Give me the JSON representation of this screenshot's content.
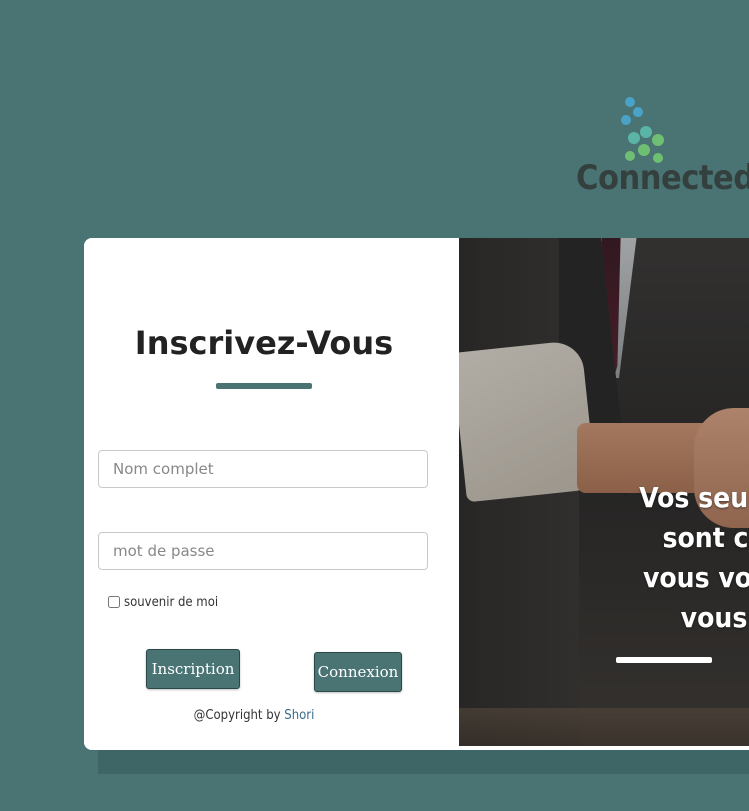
{
  "brand": {
    "name": "Connected",
    "logo_icon": "molecule-x-icon",
    "colors": {
      "primary": "#4a7474",
      "logo_blue": "#4aa3c7",
      "logo_green": "#6fbf73",
      "text_dark": "#34403e"
    }
  },
  "form": {
    "title": "Inscrivez-Vous",
    "name_placeholder": "Nom complet",
    "password_placeholder": "mot de passe",
    "remember_label": "souvenir de moi",
    "remember_checked": false,
    "signup_button": "Inscription",
    "login_button": "Connexion",
    "copyright_prefix": "@Copyright by ",
    "copyright_name": "Shori"
  },
  "hero": {
    "slogan_lines": [
      "Vos seules",
      "sont ce",
      "vous vous",
      "vous"
    ]
  }
}
